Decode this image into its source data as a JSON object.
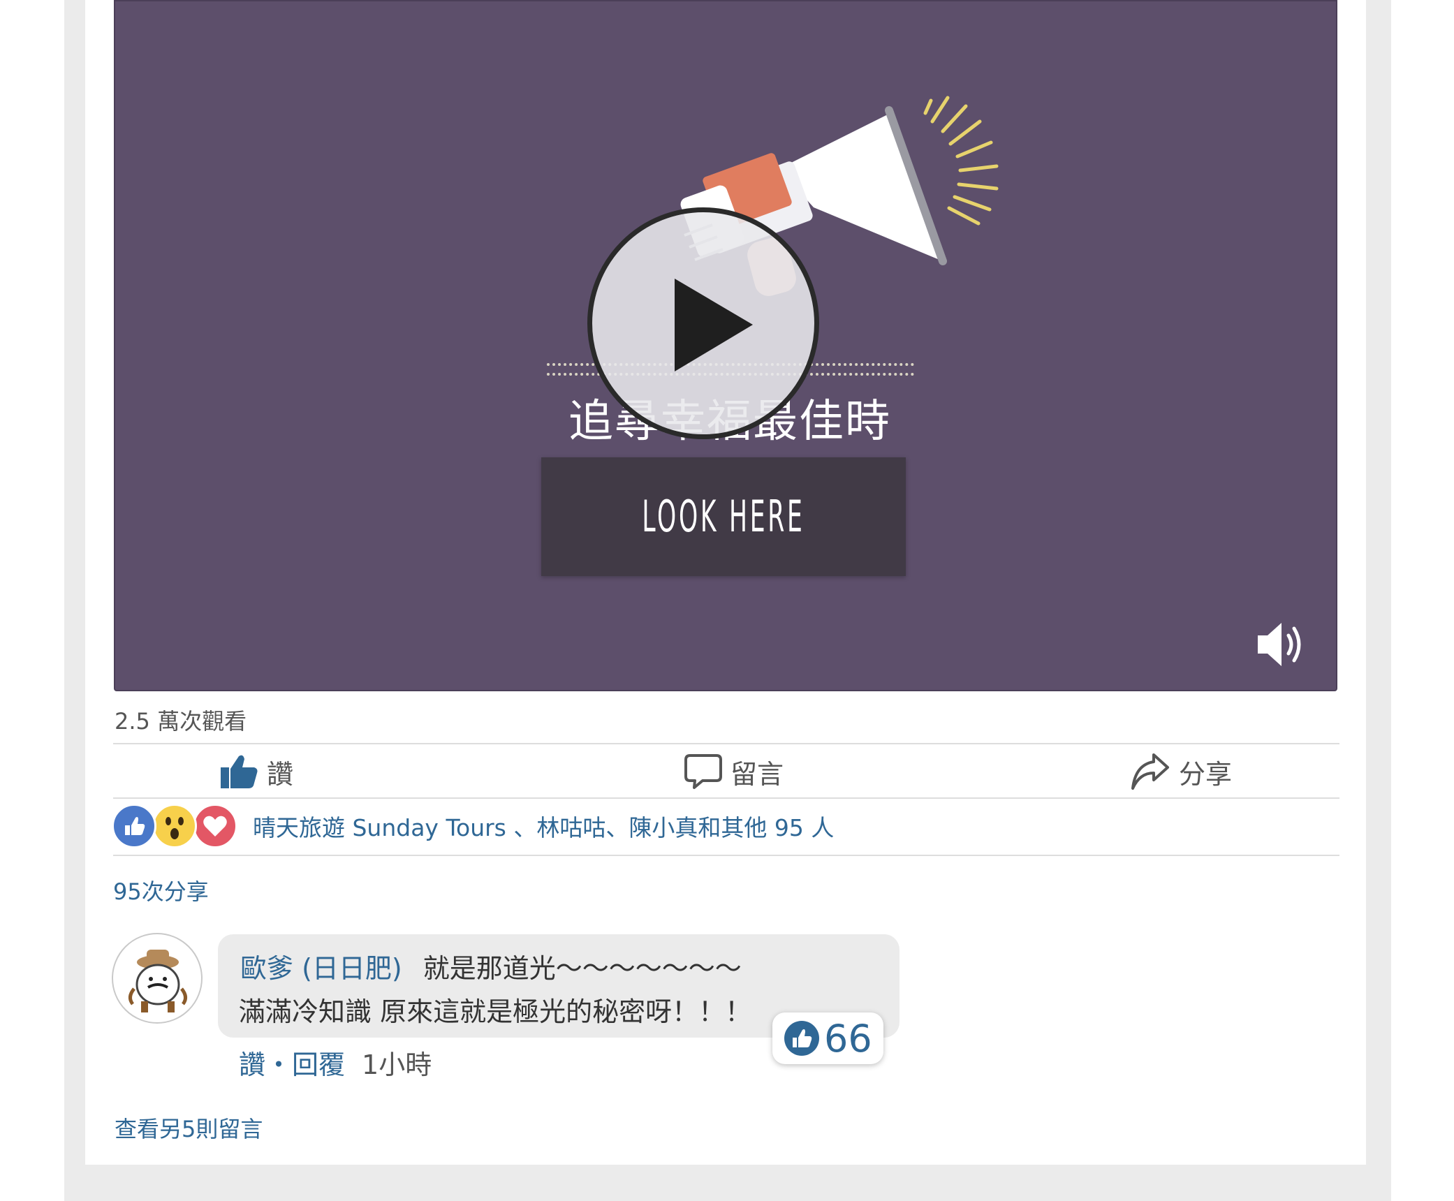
{
  "video": {
    "headline": "追尋幸福最佳時機？",
    "button_text": "LOOK HERE",
    "background_color": "#5d4f6b",
    "icons": [
      "megaphone-illustration",
      "play-icon",
      "volume-icon"
    ]
  },
  "post": {
    "views": "2.5 萬次觀看",
    "actions": {
      "like": "讚",
      "comment": "留言",
      "share": "分享"
    },
    "reactions": {
      "types": [
        "like",
        "wow",
        "love"
      ],
      "names_text": "晴天旅遊 Sunday Tours 、林咕咕、陳小真和其他 95 人"
    },
    "shares": "95次分享"
  },
  "comment": {
    "author": "歐爹 (日日肥)",
    "text_line1": "就是那道光～～～～～～～",
    "text_line2": "滿滿冷知識 原來這就是極光的秘密呀！！！",
    "like_count": "66",
    "like_action": "讚",
    "separator": "・",
    "reply_action": "回覆",
    "time": "1小時"
  },
  "view_more": "查看另5則留言",
  "colors": {
    "link": "#2f6795",
    "text": "#555555",
    "like_blue": "#4a78c9"
  }
}
